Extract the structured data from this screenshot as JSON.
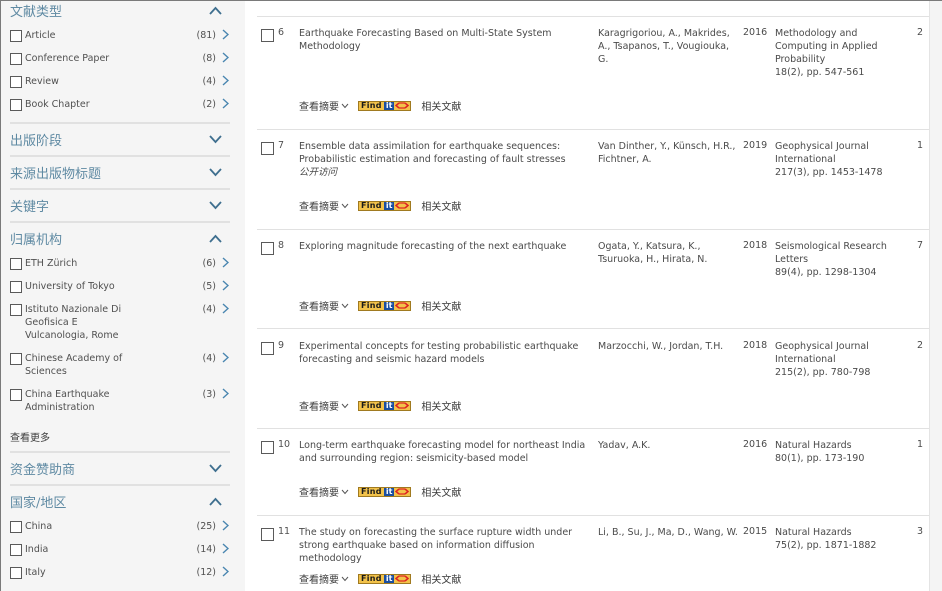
{
  "sidebar": {
    "facets": [
      {
        "title": "文献类型",
        "expanded": true,
        "items": [
          {
            "label": "Article",
            "count": "(81)"
          },
          {
            "label": "Conference Paper",
            "count": "(8)"
          },
          {
            "label": "Review",
            "count": "(4)"
          },
          {
            "label": "Book Chapter",
            "count": "(2)"
          }
        ]
      },
      {
        "title": "出版阶段",
        "expanded": false,
        "items": []
      },
      {
        "title": "来源出版物标题",
        "expanded": false,
        "items": []
      },
      {
        "title": "关键字",
        "expanded": false,
        "items": []
      },
      {
        "title": "归属机构",
        "expanded": true,
        "items": [
          {
            "label": "ETH Zürich",
            "count": "(6)"
          },
          {
            "label": "University of Tokyo",
            "count": "(5)"
          },
          {
            "label": "Istituto Nazionale Di Geofisica E Vulcanologia, Rome",
            "count": "(4)"
          },
          {
            "label": "Chinese Academy of Sciences",
            "count": "(4)"
          },
          {
            "label": "China Earthquake Administration",
            "count": "(3)"
          }
        ],
        "see_more": "查看更多"
      },
      {
        "title": "资金赞助商",
        "expanded": false,
        "items": []
      },
      {
        "title": "国家/地区",
        "expanded": true,
        "items": [
          {
            "label": "China",
            "count": "(25)"
          },
          {
            "label": "India",
            "count": "(14)"
          },
          {
            "label": "Italy",
            "count": "(12)"
          }
        ]
      }
    ]
  },
  "actions": {
    "view_abstract": "查看摘要",
    "findit_label": "Find",
    "findit_it": "it",
    "related": "相关文献"
  },
  "results": [
    {
      "num": "6",
      "title": "Earthquake Forecasting Based on Multi-State System Methodology",
      "open_access": "",
      "authors": "Karagrigoriou, A., Makrides, A., Tsapanos, T., Vougiouka, G.",
      "year": "2016",
      "source": "Methodology and Computing in Applied Probability",
      "source_detail": "18(2), pp. 547-561",
      "cites": "2"
    },
    {
      "num": "7",
      "title": "Ensemble data assimilation for earthquake sequences: Probabilistic estimation and forecasting of fault stresses",
      "open_access": "公开访问",
      "authors": "Van Dinther, Y., Künsch, H.R., Fichtner, A.",
      "year": "2019",
      "source": "Geophysical Journal International",
      "source_detail": "217(3), pp. 1453-1478",
      "cites": "1"
    },
    {
      "num": "8",
      "title": "Exploring magnitude forecasting of the next earthquake",
      "open_access": "",
      "authors": "Ogata, Y., Katsura, K., Tsuruoka, H., Hirata, N.",
      "year": "2018",
      "source": "Seismological Research Letters",
      "source_detail": "89(4), pp. 1298-1304",
      "cites": "7"
    },
    {
      "num": "9",
      "title": "Experimental concepts for testing probabilistic earthquake forecasting and seismic hazard models",
      "open_access": "",
      "authors": "Marzocchi, W., Jordan, T.H.",
      "year": "2018",
      "source": "Geophysical Journal International",
      "source_detail": "215(2), pp. 780-798",
      "cites": "2"
    },
    {
      "num": "10",
      "title": "Long-term earthquake forecasting model for northeast India and surrounding region: seismicity-based model",
      "open_access": "",
      "authors": "Yadav, A.K.",
      "year": "2016",
      "source": "Natural Hazards",
      "source_detail": "80(1), pp. 173-190",
      "cites": "1"
    },
    {
      "num": "11",
      "title": "The study on forecasting the surface rupture width under strong earthquake based on information diffusion methodology",
      "open_access": "",
      "authors": "Li, B., Su, J., Ma, D., Wang, W.",
      "year": "2015",
      "source": "Natural Hazards",
      "source_detail": "75(2), pp. 1871-1882",
      "cites": "3"
    }
  ]
}
